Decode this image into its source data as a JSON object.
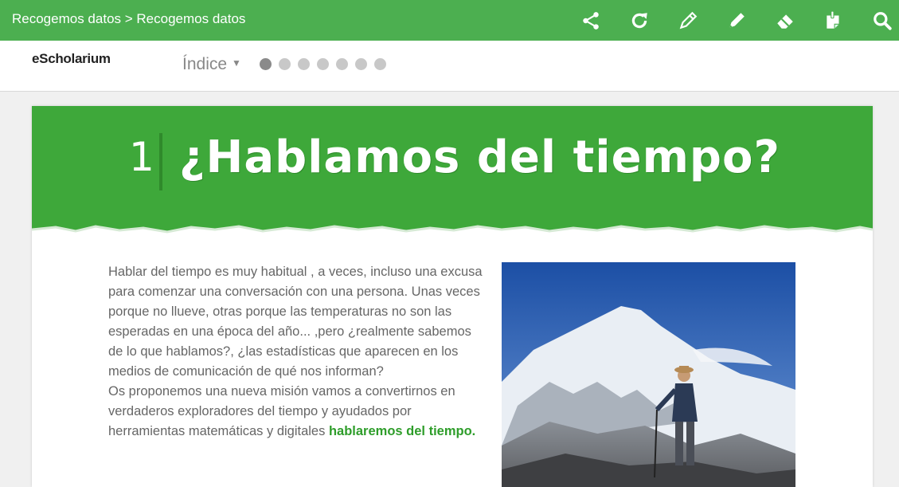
{
  "header": {
    "breadcrumb": "Recogemos datos > Recogemos datos",
    "tools": [
      "share-icon",
      "refresh-icon",
      "pencil-outline-icon",
      "pencil-icon",
      "eraser-icon",
      "notes-icon",
      "search-icon"
    ]
  },
  "nav": {
    "logo": "eScholarium",
    "indice_label": "Índice",
    "pages_total": 7,
    "current_page": 1
  },
  "chapter": {
    "number": "1",
    "title": "¿Hablamos del tiempo?"
  },
  "content": {
    "paragraph1": "Hablar del tiempo es muy habitual , a veces, incluso una excusa para comenzar una conversación con una persona. Unas veces porque no llueve, otras porque las temperaturas no son las esperadas en una época del año... ,pero ¿realmente sabemos de lo que hablamos?, ¿las estadísticas que aparecen en los medios de comunicación de qué nos informan?",
    "paragraph2": "Os proponemos una nueva misión vamos a convertirnos en verdaderos exploradores del tiempo y ayudados por herramientas matemáticas y digitales ",
    "paragraph2_highlight": "hablaremos del tiempo."
  },
  "colors": {
    "brand_green": "#4caf50",
    "banner_green": "#3ea83a",
    "highlight_green": "#2e9d2a"
  }
}
